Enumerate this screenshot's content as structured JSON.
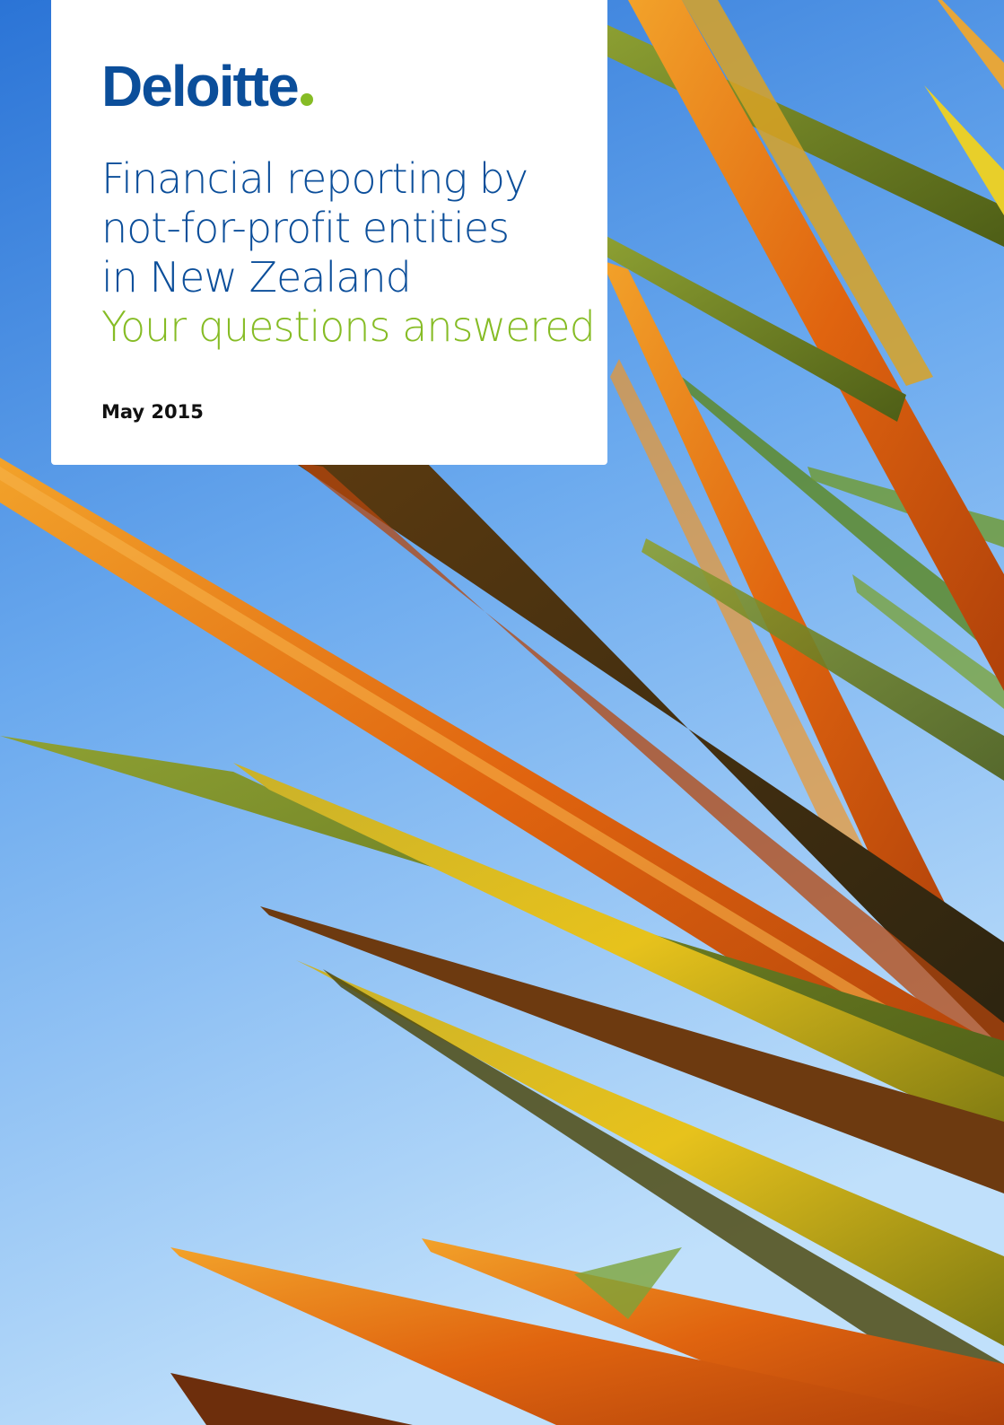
{
  "cover": {
    "logo": "Deloitte",
    "title_lines": [
      "Financial reporting by",
      "not-for-profit entities",
      "in New Zealand"
    ],
    "subtitle": "Your questions answered",
    "date": "May 2015"
  },
  "colors": {
    "brand_blue": "#0b4e9a",
    "brand_green": "#86bc25",
    "sky_top": "#2f7bd9",
    "sky_bottom": "#b9dcfb"
  },
  "background_image": "flax leaves against blue sky"
}
